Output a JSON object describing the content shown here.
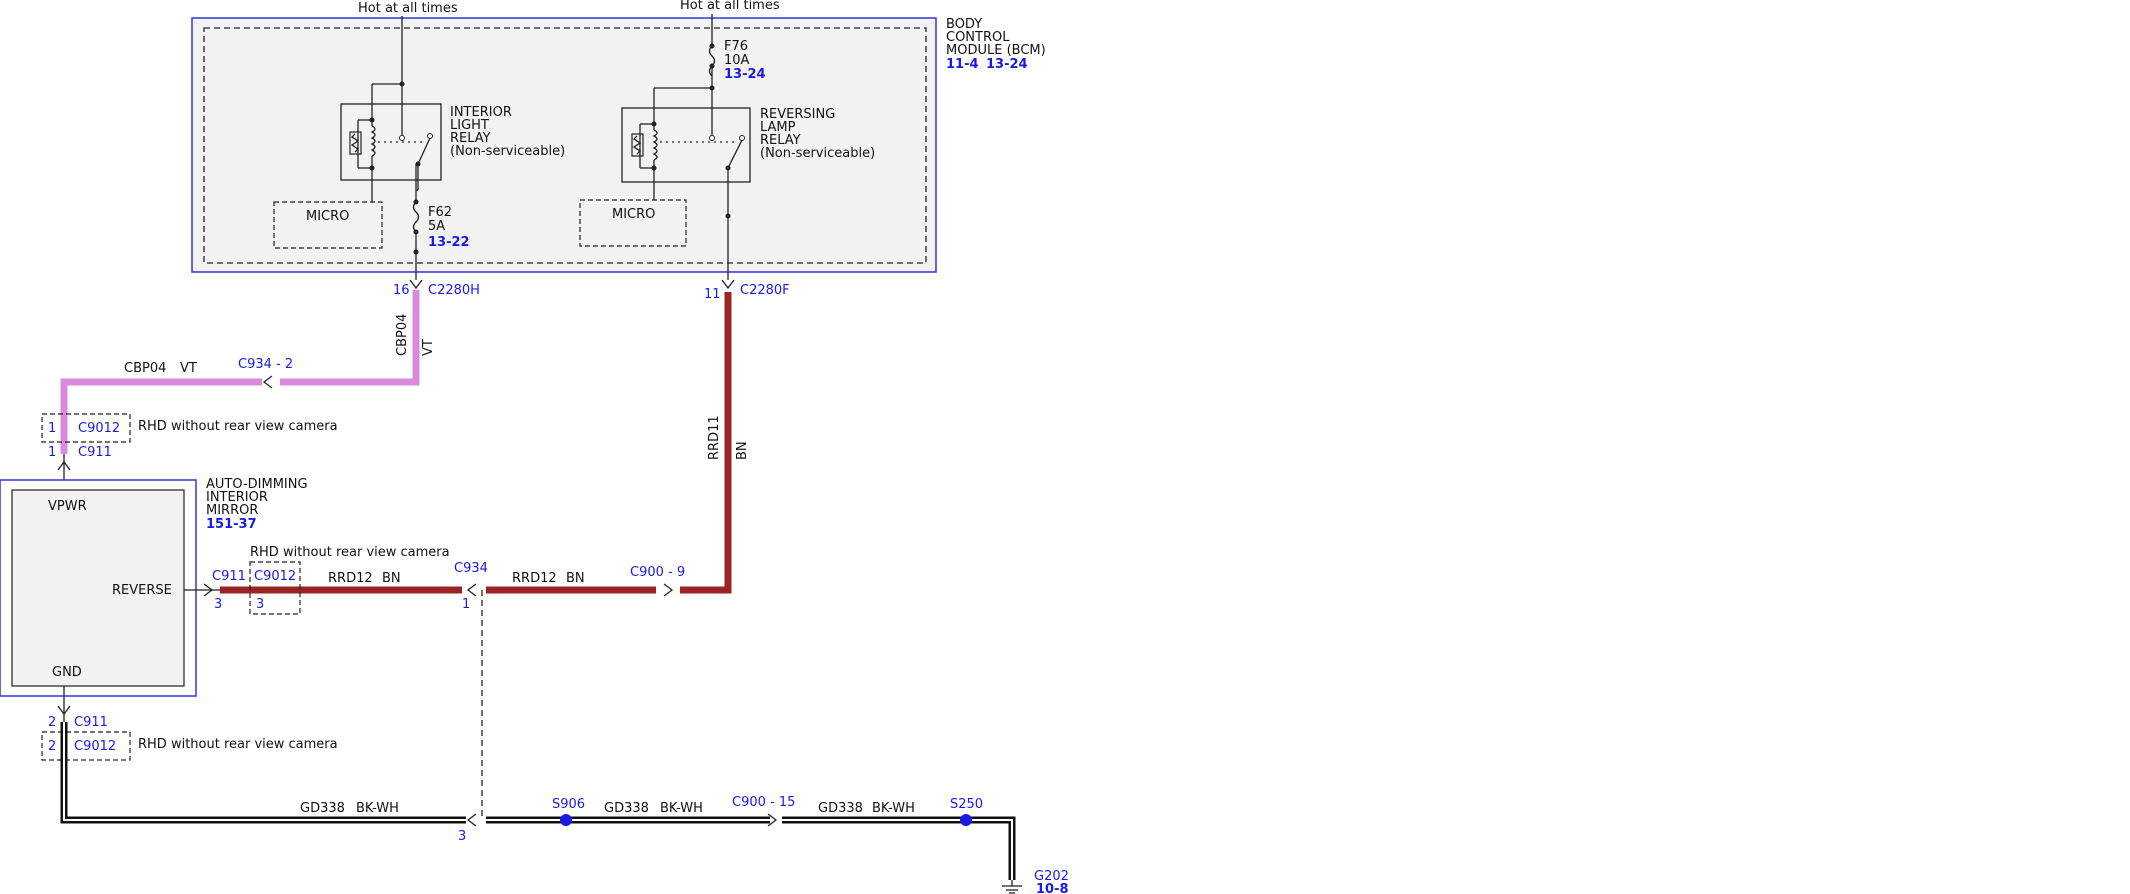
{
  "bcm": {
    "name_lines": [
      "BODY",
      "CONTROL",
      "MODULE (BCM)"
    ],
    "refs": [
      "11-4",
      "13-24"
    ],
    "hot1": "Hot at all times",
    "hot2": "Hot at all times"
  },
  "relay_interior": {
    "lines": [
      "INTERIOR",
      "LIGHT",
      "RELAY",
      "(Non-serviceable)"
    ],
    "micro": "MICRO"
  },
  "relay_reversing": {
    "lines": [
      "REVERSING",
      "LAMP",
      "RELAY",
      "(Non-serviceable)"
    ],
    "micro": "MICRO"
  },
  "fuse_f76": {
    "name": "F76",
    "rating": "10A",
    "ref": "13-24"
  },
  "fuse_f62": {
    "name": "F62",
    "rating": "5A",
    "ref": "13-22"
  },
  "connectors": {
    "c2280h": {
      "pin": "16",
      "name": "C2280H"
    },
    "c2280f": {
      "pin": "11",
      "name": "C2280F"
    },
    "c934_2": "C934 - 2",
    "c934": {
      "name": "C934",
      "pin1": "1",
      "pin3": "3"
    },
    "c9012_top": {
      "pin": "1",
      "name": "C9012"
    },
    "c911_top": {
      "pin": "1",
      "name": "C911"
    },
    "c911_mid": {
      "pin": "3",
      "name": "C911"
    },
    "c9012_mid": {
      "pin": "3",
      "name": "C9012"
    },
    "c900_9": "C900 - 9",
    "c911_bot": {
      "pin": "2",
      "name": "C911"
    },
    "c9012_bot": {
      "pin": "2",
      "name": "C9012"
    },
    "c900_15": "C900 - 15"
  },
  "rhd_note": "RHD without rear view camera",
  "wires": {
    "cbp04_vertical": {
      "circuit": "CBP04",
      "color": "VT"
    },
    "cbp04_horizontal": {
      "circuit": "CBP04",
      "color": "VT"
    },
    "rrd11": {
      "circuit": "RRD11",
      "color": "BN"
    },
    "rrd12_left": {
      "circuit": "RRD12",
      "color": "BN"
    },
    "rrd12_right": {
      "circuit": "RRD12",
      "color": "BN"
    },
    "gd338_a": {
      "circuit": "GD338",
      "color": "BK-WH"
    },
    "gd338_b": {
      "circuit": "GD338",
      "color": "BK-WH"
    },
    "gd338_c": {
      "circuit": "GD338",
      "color": "BK-WH"
    }
  },
  "mirror": {
    "name_lines": [
      "AUTO-DIMMING",
      "INTERIOR",
      "MIRROR"
    ],
    "ref": "151-37",
    "vpwr": "VPWR",
    "reverse": "REVERSE",
    "gnd": "GND"
  },
  "splices": {
    "s906": "S906",
    "s250": "S250"
  },
  "ground": {
    "name": "G202",
    "ref": "10-8"
  },
  "colors": {
    "vt": "#d98ad9",
    "bn": "#9b2323",
    "bk": "#111111",
    "link": "#1a1ae6",
    "module_border": "#3333dd",
    "module_fill": "#f2f2f2"
  }
}
